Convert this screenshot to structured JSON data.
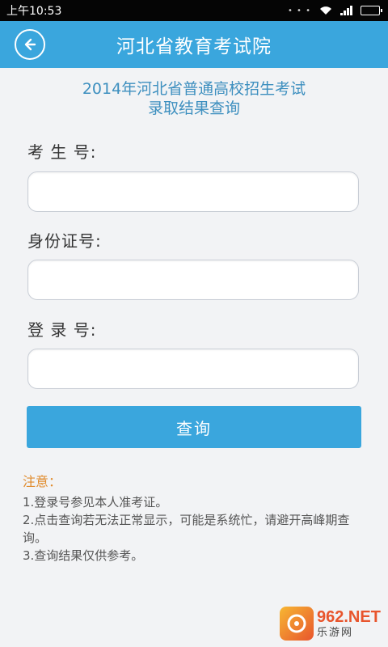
{
  "status_bar": {
    "time": "上午10:53"
  },
  "header": {
    "title": "河北省教育考试院"
  },
  "subtitle": {
    "line1": "2014年河北省普通高校招生考试",
    "line2": "录取结果查询"
  },
  "form": {
    "exam_number_label": "考 生 号:",
    "id_number_label": "身份证号:",
    "login_number_label": "登 录 号:",
    "exam_number_value": "",
    "id_number_value": "",
    "login_number_value": ""
  },
  "query_button": {
    "label": "查询"
  },
  "notice": {
    "title": "注意：",
    "items": [
      "1.登录号参见本人准考证。",
      "2.点击查询若无法正常显示，可能是系统忙，请避开高峰期查询。",
      "3.查询结果仅供参考。"
    ]
  },
  "watermark": {
    "brand": "962.NET",
    "sub": "乐游网"
  },
  "colors": {
    "accent": "#3aa6dd",
    "notice": "#e08a2a",
    "subtitle": "#3d8fbf"
  },
  "icons": {
    "back": "back-arrow-icon",
    "wifi": "wifi-icon",
    "signal": "signal-icon",
    "battery": "battery-icon"
  }
}
